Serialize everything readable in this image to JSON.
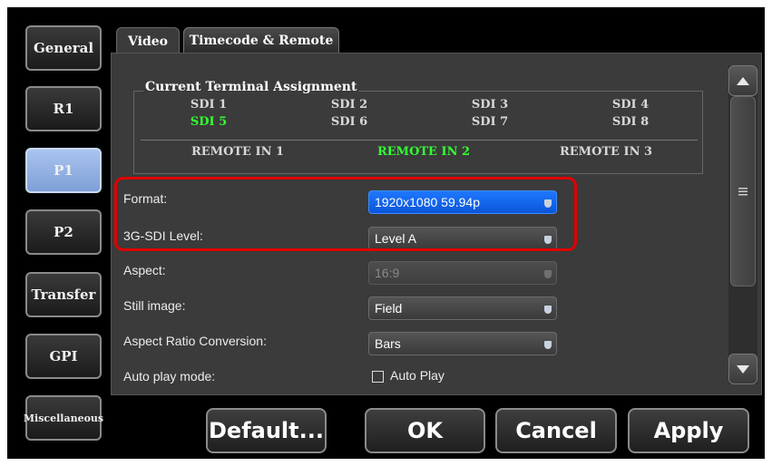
{
  "sidebar": {
    "items": [
      {
        "label": "General"
      },
      {
        "label": "R1"
      },
      {
        "label": "P1",
        "active": true
      },
      {
        "label": "P2"
      },
      {
        "label": "Transfer"
      },
      {
        "label": "GPI"
      },
      {
        "label": "Miscellaneous"
      }
    ]
  },
  "tabs": [
    {
      "label": "Video",
      "active": true
    },
    {
      "label": "Timecode & Remote",
      "active": false
    }
  ],
  "terminal": {
    "legend": "Current Terminal Assignment",
    "sdi_row1": [
      "SDI 1",
      "SDI 2",
      "SDI 3",
      "SDI 4"
    ],
    "sdi_row2": [
      "SDI 5",
      "SDI 6",
      "SDI 7",
      "SDI 8"
    ],
    "remote": [
      "REMOTE IN 1",
      "REMOTE IN 2",
      "REMOTE IN 3"
    ],
    "active_color": "#33ff33",
    "inactive_color": "#d8d8d8"
  },
  "settings": {
    "format": {
      "label": "Format:",
      "value": "1920x1080 59.94p"
    },
    "level": {
      "label": "3G-SDI Level:",
      "value": "Level A"
    },
    "aspect": {
      "label": "Aspect:",
      "value": "16:9"
    },
    "still": {
      "label": "Still image:",
      "value": "Field"
    },
    "arc": {
      "label": "Aspect Ratio Conversion:",
      "value": "Bars"
    },
    "autoplay": {
      "label": "Auto play mode:",
      "checkbox_label": "Auto Play",
      "checked": false
    }
  },
  "buttons": {
    "default": "Default...",
    "ok": "OK",
    "cancel": "Cancel",
    "apply": "Apply"
  },
  "colors": {
    "highlight": "#e00000",
    "selected_dropdown": "#1f78ff",
    "active_sidebar": "#9db8e8"
  }
}
